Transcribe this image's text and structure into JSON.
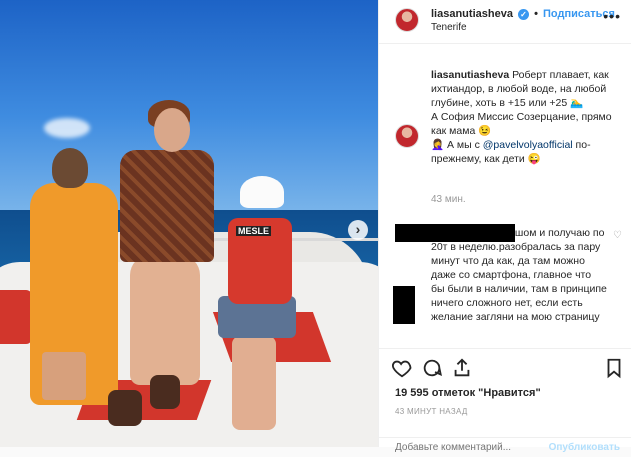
{
  "post": {
    "username": "liasanutiasheva",
    "location": "Tenerife",
    "follow_label": "Подписаться",
    "dot": "•",
    "more": "•••",
    "next_arrow": "›",
    "vest_brand": "MESLE"
  },
  "caption": {
    "username": "liasanutiasheva",
    "line1": "Роберт плавает, как ихтиандор, в любой воде, на любой глубине, хоть в +15 или +25 🏊‍♂️",
    "line2": "А София Миссис Созерцание, прямо как мама 😉",
    "line3_prefix": "🤦‍♀️ А мы с ",
    "mention": "@pavelvolyaofficial",
    "line3_suffix": " по-прежнему, как дети 😜",
    "time_ago": "43 мин."
  },
  "comment": {
    "text": "я вообще с малышом и получаю по 20т в неделю.разобралась за пару минут что да как, да там можно даже со смартфона, главное что бы были в наличии, там в принципе ничего сложного нет, если есть желание загляни на мою страницу"
  },
  "stats": {
    "likes": "19 595 отметок \"Нравится\"",
    "posted": "43 МИНУТ НАЗАД"
  },
  "add_comment": {
    "placeholder": "Добавьте комментарий...",
    "publish_label": "Опубликовать"
  },
  "colors": {
    "accent": "#3897f0",
    "text": "#262626",
    "muted": "#999999"
  },
  "icons": [
    "verified-icon",
    "more-icon",
    "heart-icon",
    "comment-icon",
    "share-icon",
    "bookmark-icon",
    "next-arrow-icon"
  ]
}
